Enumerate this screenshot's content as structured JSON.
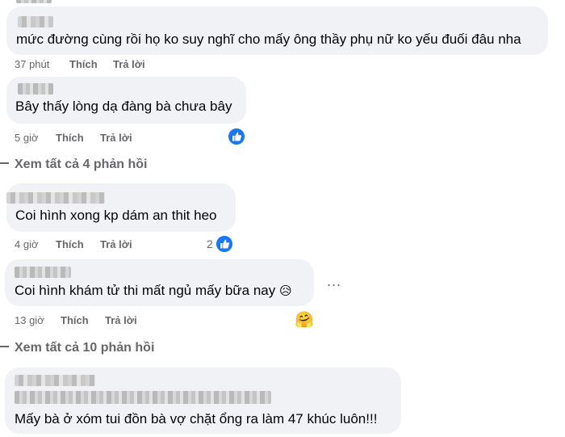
{
  "comments": [
    {
      "text": "mức đường cùng rồi họ ko suy nghĩ cho mấy ông thầy phụ nữ ko yếu đuối đâu nha",
      "time": "37 phút",
      "like": "Thích",
      "reply": "Trả lời"
    },
    {
      "text": "Bây thấy lòng dạ đàng bà chưa bây",
      "time": "5 giờ",
      "like": "Thích",
      "reply": "Trả lời",
      "reaction": "like-icon"
    },
    {
      "text": "Coi hình xong kp dám an thit heo",
      "time": "4 giờ",
      "like": "Thích",
      "reply": "Trả lời",
      "reaction": "like-icon",
      "reaction_count": "2"
    },
    {
      "text": "Coi hình khám tử thi mất ngủ mấy bữa nay",
      "emoji": "😥",
      "time": "13 giờ",
      "like": "Thích",
      "reply": "Trả lời",
      "reaction": "hug-emoji",
      "reaction_emoji": "🤗",
      "more": "..."
    },
    {
      "text": "Mấy bà ở xóm tui đồn bà vợ chặt ổng ra làm 47 khúc luôn!!!"
    }
  ],
  "view_all": [
    {
      "label": "Xem tất cả 4 phản hồi"
    },
    {
      "label": "Xem tất cả 10 phản hồi"
    }
  ],
  "colors": {
    "bubble": "#f0f2f5",
    "meta": "#65676b",
    "like_blue": "#1877f2"
  }
}
